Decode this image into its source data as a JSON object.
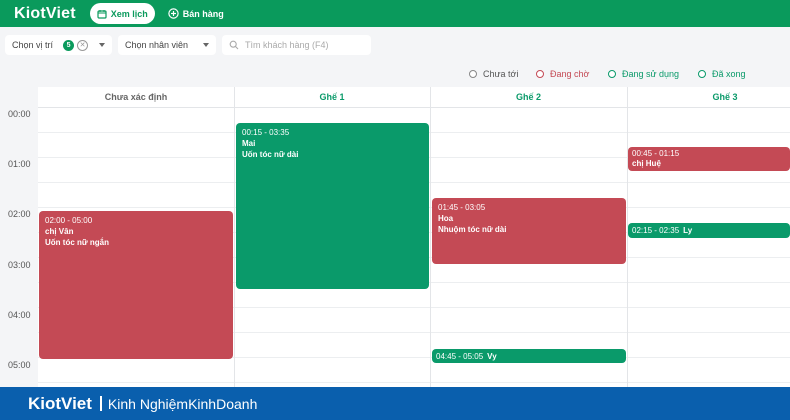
{
  "app": {
    "brand": "KiotViet"
  },
  "nav": {
    "schedule_label": "Xem lịch",
    "sales_label": "Bán hàng"
  },
  "filters": {
    "location_label": "Chọn vị trí",
    "location_count": "5",
    "staff_label": "Chọn nhân viên",
    "search_placeholder": "Tìm khách hàng (F4)"
  },
  "legend": [
    {
      "label": "Chưa tới",
      "color": "#555555"
    },
    {
      "label": "Đang chờ",
      "color": "#c44a55"
    },
    {
      "label": "Đang sử dụng",
      "color": "#0a9a6a"
    },
    {
      "label": "Đã xong",
      "color": "#0a9a6a"
    }
  ],
  "columns": [
    {
      "label": "Chưa xác định",
      "color": "#666666"
    },
    {
      "label": "Ghế 1",
      "color": "#0a9a6a"
    },
    {
      "label": "Ghế 2",
      "color": "#0a9a6a"
    },
    {
      "label": "Ghế 3",
      "color": "#0a9a6a"
    }
  ],
  "time_labels": [
    "00:00",
    "01:00",
    "02:00",
    "03:00",
    "04:00",
    "05:00"
  ],
  "events": [
    {
      "time": "02:00 - 05:00",
      "customer": "chị Vân",
      "service": "Uốn tóc nữ ngắn",
      "status": "Đang chờ"
    },
    {
      "time": "00:15 - 03:35",
      "customer": "Mai",
      "service": "Uốn tóc nữ dài",
      "status": "Đang sử dụng"
    },
    {
      "time": "01:45 - 03:05",
      "customer": "Hoa",
      "service": "Nhuộm tóc nữ dài",
      "status": "Đang chờ"
    },
    {
      "time": "04:45 - 05:05",
      "customer": "Vy",
      "service": "",
      "status": "Đang sử dụng"
    },
    {
      "time": "00:45 - 01:15",
      "customer": "chị Huệ",
      "service": "",
      "status": "Đang chờ"
    },
    {
      "time": "02:15 - 02:35",
      "customer": "Ly",
      "service": "",
      "status": "Đang sử dụng"
    }
  ],
  "footer": {
    "brand": "KiotViet",
    "tagline": "Kinh NghiệmKinhDoanh"
  }
}
